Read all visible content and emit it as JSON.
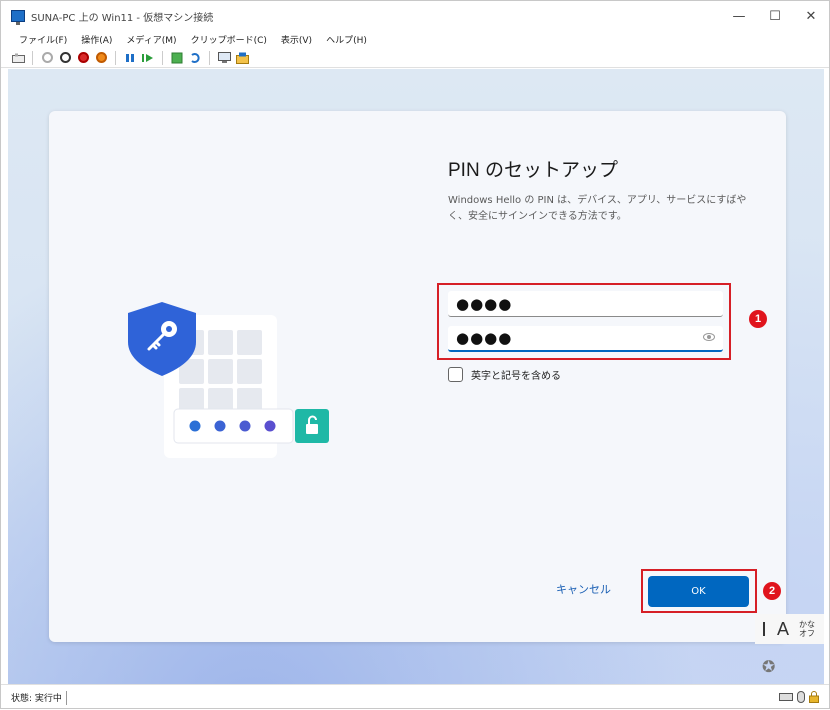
{
  "window": {
    "title": "SUNA-PC 上の Win11 - 仮想マシン接続",
    "controls": [
      "—",
      "☐",
      "✕"
    ]
  },
  "menu": [
    "ファイル(F)",
    "操作(A)",
    "メディア(M)",
    "クリップボード(C)",
    "表示(V)",
    "ヘルプ(H)"
  ],
  "setup": {
    "heading": "PIN のセットアップ",
    "description": "Windows Hello の PIN は、デバイス、アプリ、サービスにすばやく、安全にサインインできる方法です。",
    "new_pin": "●●●●",
    "confirm_pin": "●●●●",
    "checkbox_label": "英字と記号を含める",
    "cancel_label": "キャンセル",
    "ok_label": "OK"
  },
  "annotations": {
    "badge1": "1",
    "badge2": "2"
  },
  "ime": {
    "mode": "A",
    "kana_line1": "かな",
    "kana_line2": "オフ"
  },
  "status": {
    "text": "状態: 実行中"
  },
  "colors": {
    "accent": "#0067c0",
    "annotation_red": "#d61f26",
    "shield": "#2f63d8",
    "lock": "#1fb8a6"
  }
}
